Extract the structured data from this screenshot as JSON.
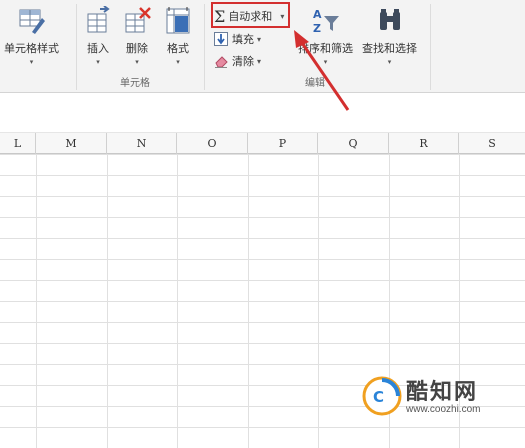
{
  "ribbon": {
    "cell_style_label": "单元格样式",
    "insert_label": "插入",
    "delete_label": "删除",
    "format_label": "格式",
    "cells_group_label": "单元格",
    "autosum_label": "自动求和",
    "fill_label": "填充",
    "clear_label": "清除",
    "sort_filter_label": "排序和筛选",
    "find_select_label": "查找和选择",
    "editing_group_label": "编辑",
    "dropdown_caret": "▾",
    "sigma": "Σ"
  },
  "sheet": {
    "columns": [
      "L",
      "M",
      "N",
      "O",
      "P",
      "Q",
      "R",
      "S"
    ]
  },
  "watermark": {
    "title": "酷知网",
    "url": "www.coozhi.com"
  },
  "colors": {
    "highlight": "#d32f2f",
    "arrow": "#d32f2f"
  }
}
